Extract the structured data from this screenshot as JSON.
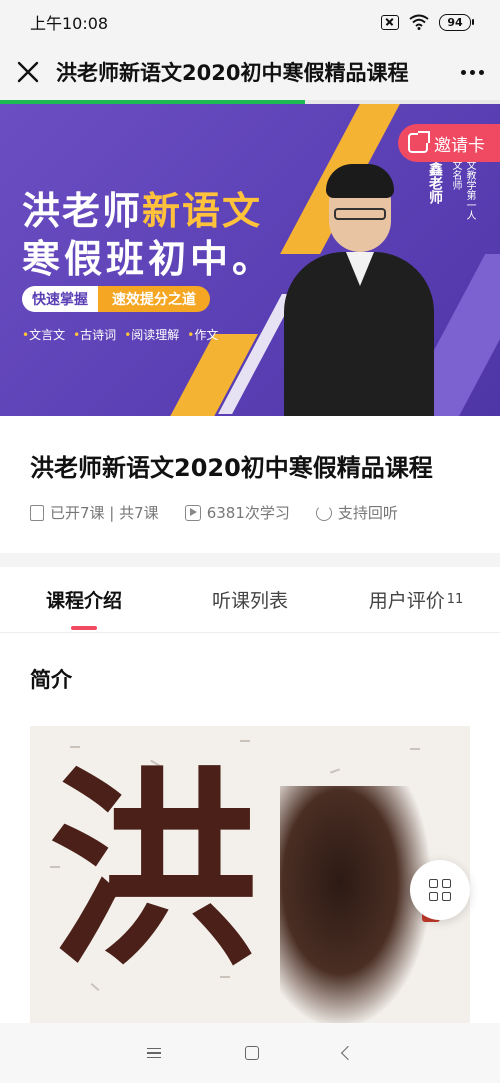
{
  "status_bar": {
    "time": "上午10:08",
    "battery": "94"
  },
  "header": {
    "title": "洪老师新语文2020初中寒假精品课程",
    "progress_fraction": 0.61
  },
  "banner": {
    "title_line1_prefix": "洪老师",
    "title_line1_highlight": "新语文",
    "title_line2": "寒假班初中。",
    "pill_left": "快速掌握",
    "pill_right": "速效提分之道",
    "topics": [
      "文言文",
      "古诗词",
      "阅读理解",
      "作文"
    ],
    "teacher_name": "洪鑫老师",
    "teacher_desc_1": "语文名师",
    "teacher_desc_2": "语文教学第一人",
    "invite_label": "邀请卡"
  },
  "course": {
    "title": "洪老师新语文2020初中寒假精品课程",
    "lessons": "已开7课 | 共7课",
    "views": "6381次学习",
    "replay": "支持回听"
  },
  "tabs": [
    {
      "label": "课程介绍",
      "active": true
    },
    {
      "label": "听课列表",
      "active": false
    },
    {
      "label": "用户评价",
      "count": "11",
      "active": false
    }
  ],
  "section": {
    "intro_title": "简介"
  },
  "intro_image": {
    "glyph": "洪"
  },
  "colors": {
    "accent": "#f04a63",
    "banner_purple": "#5a3fb4",
    "banner_yellow": "#f5b333",
    "progress_green": "#1db954"
  },
  "icons": [
    "close-icon",
    "more-icon",
    "invite-icon",
    "calendar-icon",
    "play-icon",
    "replay-icon",
    "grid-icon",
    "menu-icon",
    "home-icon",
    "back-icon"
  ]
}
